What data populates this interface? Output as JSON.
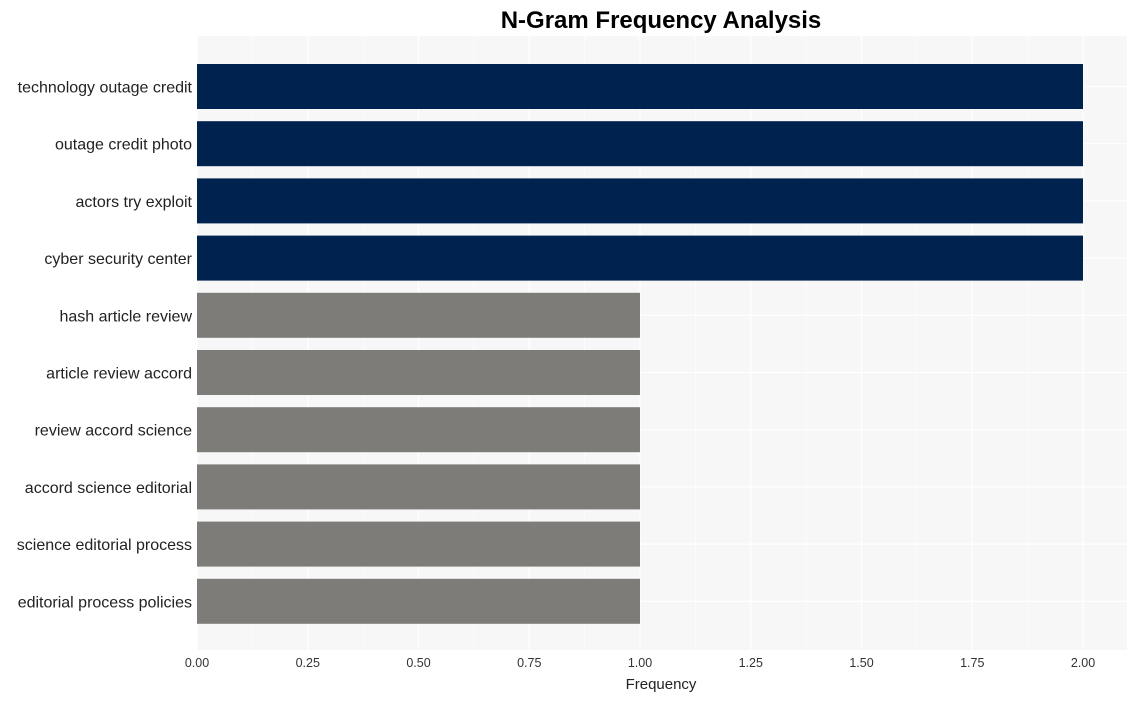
{
  "chart_data": {
    "type": "bar",
    "orientation": "horizontal",
    "title": "N-Gram Frequency Analysis",
    "xlabel": "Frequency",
    "ylabel": "",
    "xlim": [
      0,
      2.1
    ],
    "xticks": [
      0.0,
      0.25,
      0.5,
      0.75,
      1.0,
      1.25,
      1.5,
      1.75,
      2.0
    ],
    "xtick_labels": [
      "0.00",
      "0.25",
      "0.50",
      "0.75",
      "1.00",
      "1.25",
      "1.50",
      "1.75",
      "2.00"
    ],
    "grid": true,
    "legend": "none",
    "categories": [
      "technology outage credit",
      "outage credit photo",
      "actors try exploit",
      "cyber security center",
      "hash article review",
      "article review accord",
      "review accord science",
      "accord science editorial",
      "science editorial process",
      "editorial process policies"
    ],
    "values": [
      2,
      2,
      2,
      2,
      1,
      1,
      1,
      1,
      1,
      1
    ],
    "bar_colors": [
      "#00224e",
      "#00224e",
      "#00224e",
      "#00224e",
      "#7d7c78",
      "#7d7c78",
      "#7d7c78",
      "#7d7c78",
      "#7d7c78",
      "#7d7c78"
    ],
    "panel_background": "#f7f7f7",
    "grid_color": "#ffffff"
  }
}
